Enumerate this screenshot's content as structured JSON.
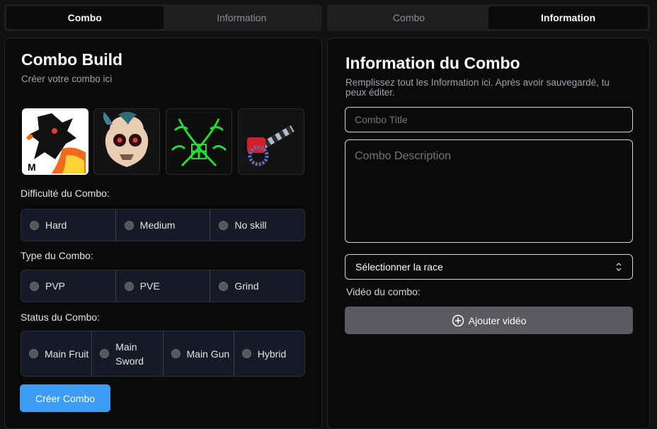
{
  "left": {
    "tabs": [
      {
        "label": "Combo"
      },
      {
        "label": "Information"
      }
    ],
    "title": "Combo Build",
    "subtitle": "Créer votre combo ici",
    "images": [
      {
        "name": "dragon-fruit-image",
        "selected": true
      },
      {
        "name": "skull-boss-image",
        "selected": false
      },
      {
        "name": "crossed-swords-image",
        "selected": false
      },
      {
        "name": "gun-image",
        "selected": false
      }
    ],
    "difficulty": {
      "label": "Difficulté du Combo:",
      "options": [
        "Hard",
        "Medium",
        "No skill"
      ]
    },
    "type": {
      "label": "Type du Combo:",
      "options": [
        "PVP",
        "PVE",
        "Grind"
      ]
    },
    "status": {
      "label": "Status du Combo:",
      "options": [
        "Main Fruit",
        "Main Sword",
        "Main Gun",
        "Hybrid"
      ]
    },
    "create_button": "Créer Combo"
  },
  "right": {
    "tabs": [
      {
        "label": "Combo"
      },
      {
        "label": "Information"
      }
    ],
    "title": "Information du Combo",
    "subtitle": "Remplissez tout les Information ici. Après avoir sauvegardé, tu peux éditer.",
    "combo_title_placeholder": "Combo Title",
    "combo_description_placeholder": "Combo Description",
    "race_select": "Sélectionner la race",
    "video_label": "Vidéo du combo:",
    "add_video_button": "Ajouter vidéo"
  },
  "colors": {
    "accent": "#3b9cf4",
    "background": "#0a0a0b",
    "radio_bg": "#151a26"
  },
  "icons": [
    "chevron-updown-icon",
    "plus-circle-icon"
  ]
}
